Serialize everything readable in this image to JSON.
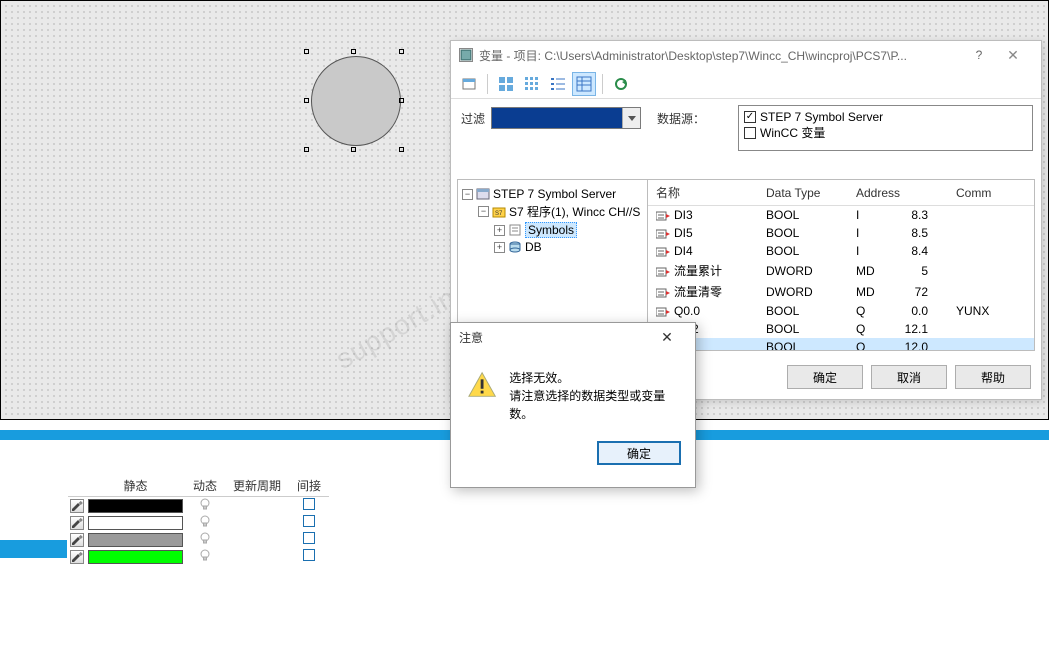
{
  "dialog": {
    "title": "变量 - 项目: C:\\Users\\Administrator\\Desktop\\step7\\Wincc_CH\\wincproj\\PCS7\\P...",
    "help_glyph": "?",
    "close_glyph": "✕",
    "filter_label": "过滤",
    "datasource_label": "数据源：",
    "datasources": [
      {
        "label": "STEP 7 Symbol Server",
        "checked": true
      },
      {
        "label": "WinCC 变量",
        "checked": false
      }
    ],
    "tree": {
      "root": "STEP 7 Symbol Server",
      "program": "S7 程序(1), Wincc CH//S",
      "symbols": "Symbols",
      "db": "DB"
    },
    "columns": {
      "name": "名称",
      "type": "Data Type",
      "addr": "Address",
      "comment": "Comm"
    },
    "rows": [
      {
        "name": "DI3",
        "type": "BOOL",
        "a1": "I",
        "a2": "8.3",
        "comment": ""
      },
      {
        "name": "DI5",
        "type": "BOOL",
        "a1": "I",
        "a2": "8.5",
        "comment": ""
      },
      {
        "name": "DI4",
        "type": "BOOL",
        "a1": "I",
        "a2": "8.4",
        "comment": ""
      },
      {
        "name": "流量累计",
        "type": "DWORD",
        "a1": "MD",
        "a2": "5",
        "comment": ""
      },
      {
        "name": "流量清零",
        "type": "DWORD",
        "a1": "MD",
        "a2": "72",
        "comment": ""
      },
      {
        "name": "Q0.0",
        "type": "BOOL",
        "a1": "Q",
        "a2": "0.0",
        "comment": "YUNX"
      },
      {
        "name": "DO2",
        "type": "BOOL",
        "a1": "Q",
        "a2": "12.1",
        "comment": ""
      },
      {
        "name": "",
        "type": "BOOL",
        "a1": "Q",
        "a2": "12.0",
        "comment": "",
        "selected": true
      }
    ],
    "buttons": {
      "ok": "确定",
      "cancel": "取消",
      "help": "帮助"
    }
  },
  "alert": {
    "title": "注意",
    "close_glyph": "✕",
    "line1": "选择无效。",
    "line2": "请注意选择的数据类型或变量数。",
    "ok": "确定"
  },
  "propgrid": {
    "headers": {
      "static": "静态",
      "dynamic": "动态",
      "refresh": "更新周期",
      "indirect": "间接"
    },
    "rows": [
      {
        "color": "#000000"
      },
      {
        "color": "#ffffff"
      },
      {
        "color": "#9a9a9a"
      },
      {
        "color": "#00ff00"
      }
    ]
  },
  "watermark": "support.industry.siemens.com   找答案   工业"
}
